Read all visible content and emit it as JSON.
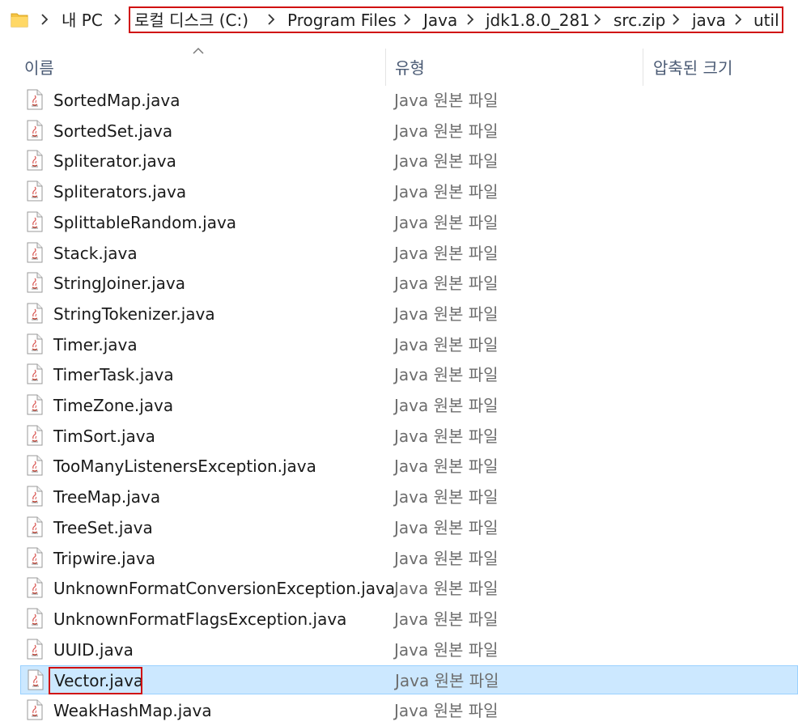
{
  "breadcrumb": [
    "내 PC",
    "로컬 디스크 (C:)",
    "Program Files",
    "Java",
    "jdk1.8.0_281",
    "src.zip",
    "java",
    "util"
  ],
  "columns": {
    "name": "이름",
    "type": "유형",
    "compressed_size": "압축된 크기"
  },
  "files": [
    {
      "name": "SortedMap.java",
      "type": "Java 원본 파일"
    },
    {
      "name": "SortedSet.java",
      "type": "Java 원본 파일"
    },
    {
      "name": "Spliterator.java",
      "type": "Java 원본 파일"
    },
    {
      "name": "Spliterators.java",
      "type": "Java 원본 파일"
    },
    {
      "name": "SplittableRandom.java",
      "type": "Java 원본 파일"
    },
    {
      "name": "Stack.java",
      "type": "Java 원본 파일"
    },
    {
      "name": "StringJoiner.java",
      "type": "Java 원본 파일"
    },
    {
      "name": "StringTokenizer.java",
      "type": "Java 원본 파일"
    },
    {
      "name": "Timer.java",
      "type": "Java 원본 파일"
    },
    {
      "name": "TimerTask.java",
      "type": "Java 원본 파일"
    },
    {
      "name": "TimeZone.java",
      "type": "Java 원본 파일"
    },
    {
      "name": "TimSort.java",
      "type": "Java 원본 파일"
    },
    {
      "name": "TooManyListenersException.java",
      "type": "Java 원본 파일"
    },
    {
      "name": "TreeMap.java",
      "type": "Java 원본 파일"
    },
    {
      "name": "TreeSet.java",
      "type": "Java 원본 파일"
    },
    {
      "name": "Tripwire.java",
      "type": "Java 원본 파일"
    },
    {
      "name": "UnknownFormatConversionException.java",
      "type": "Java 원본 파일"
    },
    {
      "name": "UnknownFormatFlagsException.java",
      "type": "Java 원본 파일"
    },
    {
      "name": "UUID.java",
      "type": "Java 원본 파일"
    },
    {
      "name": "Vector.java",
      "type": "Java 원본 파일"
    },
    {
      "name": "WeakHashMap.java",
      "type": "Java 원본 파일"
    }
  ],
  "selected_file": "Vector.java",
  "colors": {
    "selection_bg": "#cce8ff",
    "selection_border": "#99d1ff",
    "highlight": "#d01010",
    "header_text": "#4a5a74",
    "type_text": "#6d6d6d",
    "folder": "#f5c342"
  },
  "icons": {
    "folder": "folder-icon",
    "chevron": "chevron-right-icon",
    "sort": "sort-ascending-icon",
    "file": "java-file-icon"
  }
}
